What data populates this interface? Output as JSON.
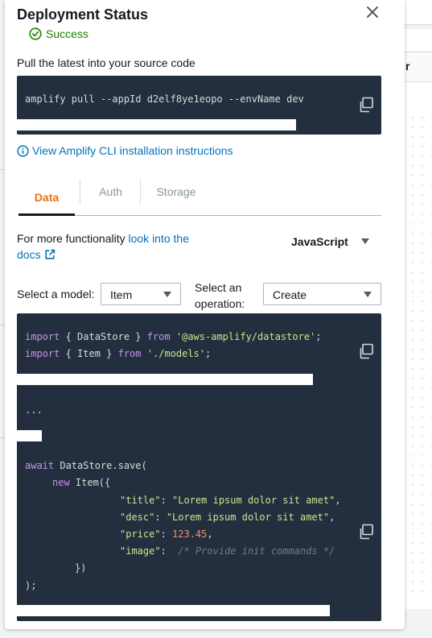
{
  "background": {
    "column_header": "r"
  },
  "panel": {
    "title": "Deployment Status",
    "status": "Success",
    "pull_label": "Pull the latest into your source code",
    "cli_command": "amplify pull --appId d2elf8ye1eopo --envName dev",
    "cli_link": "View Amplify CLI installation instructions"
  },
  "tabs": [
    {
      "label": "Data",
      "active": true
    },
    {
      "label": "Auth",
      "active": false
    },
    {
      "label": "Storage",
      "active": false
    }
  ],
  "functionality": {
    "prefix": "For more functionality",
    "link": "look into the docs",
    "language": "JavaScript"
  },
  "selectors": {
    "model_label": "Select a model:",
    "model_value": "Item",
    "operation_label": "Select an operation:",
    "operation_value": "Create"
  },
  "code": {
    "import1": {
      "kw": "import",
      "mid": " { DataStore } ",
      "kw2": "from",
      "str": "'@aws-amplify/datastore'",
      "end": ";"
    },
    "import2": {
      "kw": "import",
      "mid": " { Item } ",
      "kw2": "from",
      "str": "'./models'",
      "end": ";"
    },
    "ellipsis": "...",
    "await_kw": "await",
    "save_call": " DataStore.save(",
    "new_kw": "new",
    "item_ctor": " Item({",
    "fields": [
      {
        "key": "\"title\"",
        "value": "\"Lorem ipsum dolor sit amet\"",
        "kind": "str",
        "trail": ","
      },
      {
        "key": "\"desc\"",
        "value": "\"Lorem ipsum dolor sit amet\"",
        "kind": "str",
        "trail": ","
      },
      {
        "key": "\"price\"",
        "value": "123.45",
        "kind": "num",
        "trail": ","
      },
      {
        "key": "\"image\"",
        "value": "/* Provide init commands */",
        "kind": "cm",
        "trail": ""
      }
    ],
    "close_obj": "})",
    "close_call": ");"
  },
  "colors": {
    "accent_orange": "#ec7211",
    "link_blue": "#0073bb",
    "success_green": "#1d8102",
    "code_bg": "#232f3e"
  },
  "icons": [
    "close-icon",
    "success-check-icon",
    "copy-icon",
    "info-icon",
    "external-link-icon",
    "caret-down-icon"
  ]
}
